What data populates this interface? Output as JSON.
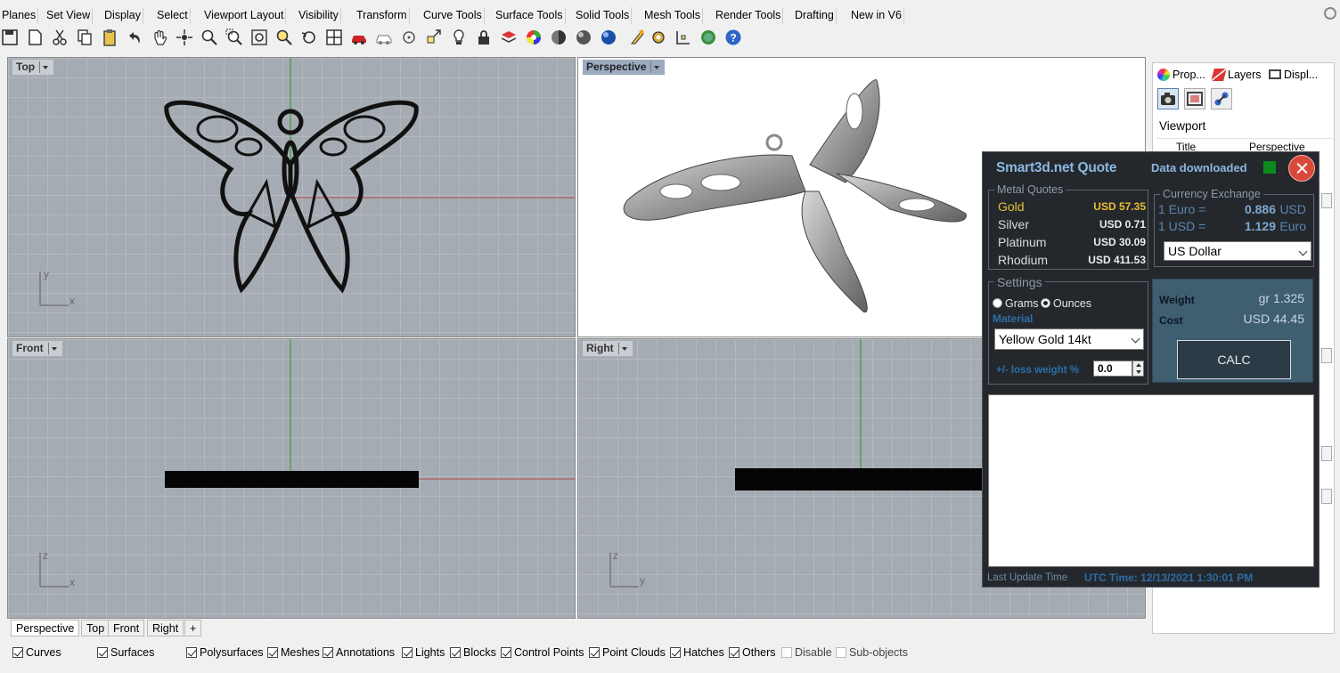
{
  "menu_tabs": [
    "Planes",
    "Set View",
    "Display",
    "Select",
    "Viewport Layout",
    "Visibility",
    "Transform",
    "Curve Tools",
    "Surface Tools",
    "Solid Tools",
    "Mesh Tools",
    "Render Tools",
    "Drafting",
    "New in V6"
  ],
  "toolbar_icons": [
    "save-icon",
    "new-icon",
    "cut-icon",
    "copy-icon",
    "paste-icon",
    "undo-icon",
    "pan-icon",
    "rotate-view-icon",
    "zoom-icon",
    "zoom-window-icon",
    "zoom-extents-icon",
    "zoom-selected-icon",
    "undo-view-icon",
    "four-viewports-icon",
    "car-icon",
    "car-outline-icon",
    "point-icon",
    "snap-icon",
    "light-icon",
    "lock-icon",
    "layer-icon",
    "color-wheel-icon",
    "shaded-icon",
    "rendered-icon",
    "render-icon",
    "sun-icon",
    "gear-icon",
    "dimension-icon",
    "globe-icon",
    "help-icon"
  ],
  "viewports": {
    "top": {
      "label": "Top",
      "axis": [
        "y",
        "x"
      ]
    },
    "perspective": {
      "label": "Perspective"
    },
    "front": {
      "label": "Front",
      "axis": [
        "z",
        "x"
      ]
    },
    "right": {
      "label": "Right",
      "axis": [
        "z",
        "y"
      ]
    }
  },
  "view_tabs": [
    "Perspective",
    "Top",
    "Front",
    "Right"
  ],
  "view_tab_add": "+",
  "osnap": [
    {
      "label": "Curves",
      "checked": true
    },
    {
      "label": "Surfaces",
      "checked": true
    },
    {
      "label": "Polysurfaces",
      "checked": true
    },
    {
      "label": "Meshes",
      "checked": true
    },
    {
      "label": "Annotations",
      "checked": true
    },
    {
      "label": "Lights",
      "checked": true
    },
    {
      "label": "Blocks",
      "checked": true
    },
    {
      "label": "Control Points",
      "checked": true
    },
    {
      "label": "Point Clouds",
      "checked": true
    },
    {
      "label": "Hatches",
      "checked": true
    },
    {
      "label": "Others",
      "checked": true
    },
    {
      "label": "Disable",
      "checked": false
    },
    {
      "label": "Sub-objects",
      "checked": false
    }
  ],
  "panel": {
    "tabs": [
      "Prop...",
      "Layers",
      "Displ..."
    ],
    "section": "Viewport",
    "row_key": "Title",
    "row_value": "Perspective"
  },
  "quote": {
    "title": "Smart3d.net Quote",
    "status": "Data downloaded",
    "status_color": "#0a8a1c",
    "metals_legend": "Metal Quotes",
    "metals": [
      {
        "name": "Gold",
        "price": "USD 57.35"
      },
      {
        "name": "Silver",
        "price": "USD 0.71"
      },
      {
        "name": "Platinum",
        "price": "USD 30.09"
      },
      {
        "name": "Rhodium",
        "price": "USD 411.53"
      }
    ],
    "currency_legend": "Currency Exchange",
    "rates": [
      {
        "label": "1 Euro =",
        "value": "0.886",
        "unit": "USD"
      },
      {
        "label": "1 USD =",
        "value": "1.129",
        "unit": "Euro"
      }
    ],
    "currency_selected": "US Dollar",
    "settings_legend": "Settings",
    "unit_grams": "Grams",
    "unit_ounces": "Ounces",
    "material_label": "Material",
    "material_selected": "Yellow Gold 14kt",
    "loss_label": "+/- loss weight %",
    "loss_value": "0.0",
    "weight_label": "Weight",
    "weight_value": "gr  1.325",
    "cost_label": "Cost",
    "cost_value": "USD  44.45",
    "calc_label": "CALC",
    "last_update_label": "Last Update Time",
    "utc_time": "UTC Time: 12/13/2021 1:30:01 PM"
  }
}
